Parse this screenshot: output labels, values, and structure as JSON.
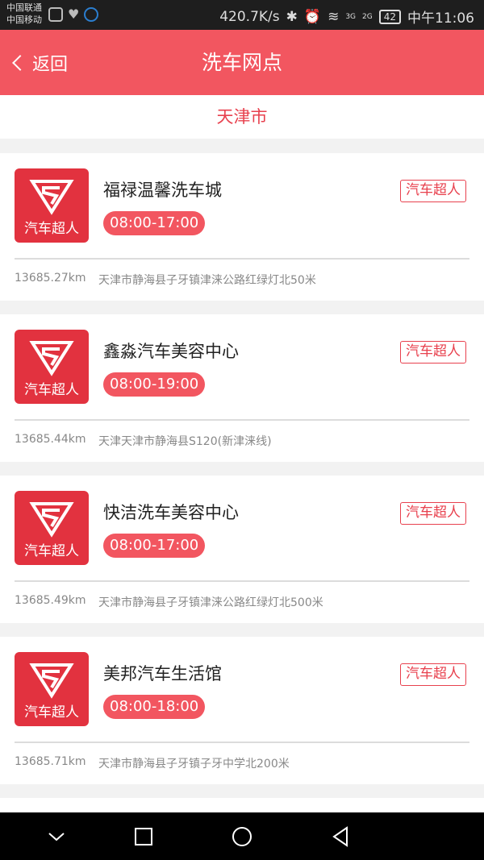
{
  "status_bar": {
    "carrier_1": "中国联通",
    "carrier_2": "中国移动",
    "speed": "420.7K/s",
    "network_1": "3G",
    "network_2": "2G",
    "battery": "42",
    "time": "中午11:06"
  },
  "header": {
    "back_label": "返回",
    "title": "洗车网点",
    "bg_color": "#f25660"
  },
  "city": "天津市",
  "shops": [
    {
      "name": "福禄温馨洗车城",
      "hours": "08:00-17:00",
      "tag": "汽车超人",
      "logo_text": "汽车超人",
      "distance": "13685.27km",
      "address": "天津市静海县子牙镇津涞公路红绿灯北50米"
    },
    {
      "name": "鑫淼汽车美容中心",
      "hours": "08:00-19:00",
      "tag": "汽车超人",
      "logo_text": "汽车超人",
      "distance": "13685.44km",
      "address": "天津天津市静海县S120(新津涞线)"
    },
    {
      "name": "快洁洗车美容中心",
      "hours": "08:00-17:00",
      "tag": "汽车超人",
      "logo_text": "汽车超人",
      "distance": "13685.49km",
      "address": "天津市静海县子牙镇津涞公路红绿灯北500米"
    },
    {
      "name": "美邦汽车生活馆",
      "hours": "08:00-18:00",
      "tag": "汽车超人",
      "logo_text": "汽车超人",
      "distance": "13685.71km",
      "address": "天津市静海县子牙镇子牙中学北200米"
    }
  ],
  "nav_bar": {
    "icons": [
      "chevron-down-icon",
      "square-icon",
      "circle-icon",
      "triangle-back-icon"
    ]
  },
  "colors": {
    "accent": "#e8414e",
    "logo_bg": "#e2323f"
  }
}
